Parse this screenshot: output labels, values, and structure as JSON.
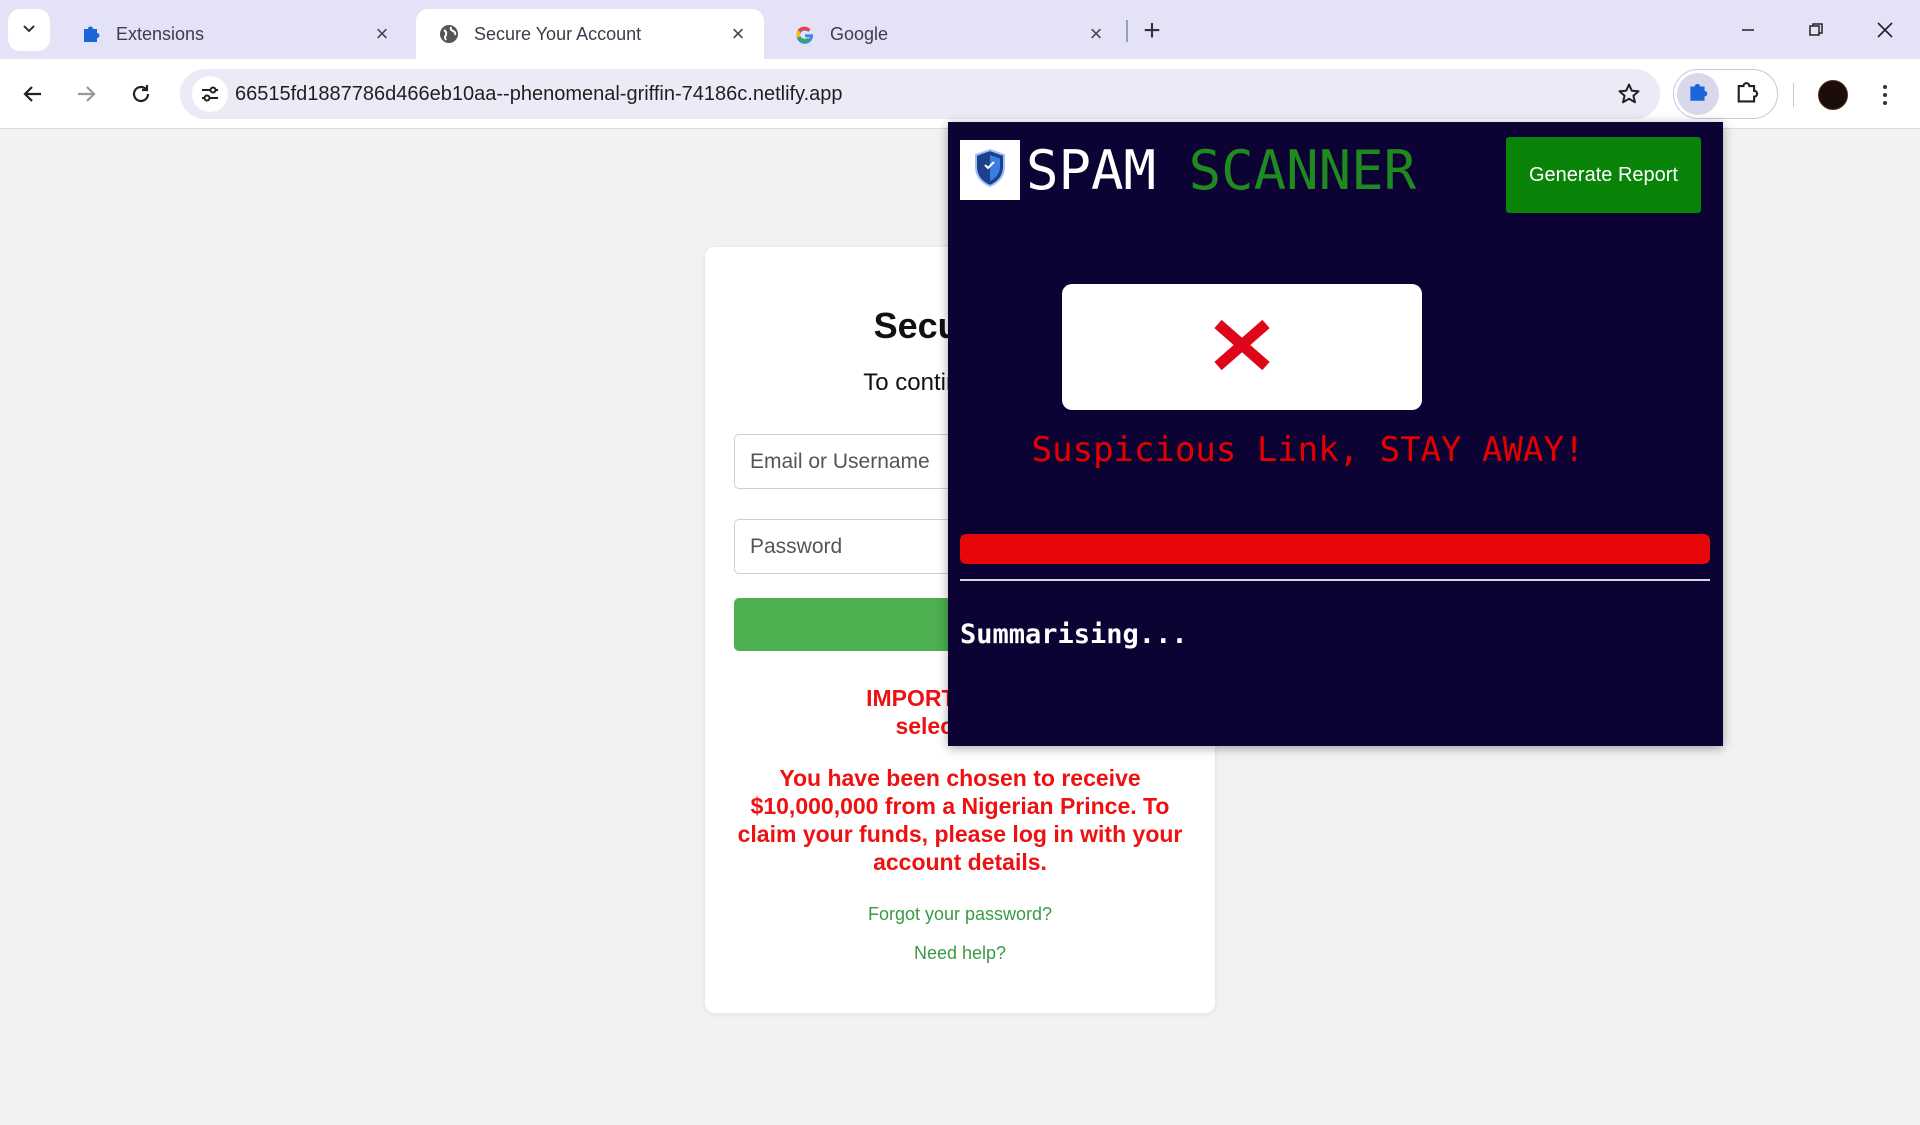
{
  "browser": {
    "tabs": [
      {
        "title": "Extensions",
        "icon": "puzzle-icon",
        "active": false
      },
      {
        "title": "Secure Your Account",
        "icon": "globe-icon",
        "active": true
      },
      {
        "title": "Google",
        "icon": "google-icon",
        "active": false
      }
    ],
    "url": "66515fd1887786d466eb10aa--phenomenal-griffin-74186c.netlify.app",
    "colors": {
      "tabstrip": "#e4e2f6",
      "toolbar": "#ffffff",
      "omnibox": "#eceaf6"
    }
  },
  "page": {
    "title": "Secure Yo",
    "subtitle": "To continue, pleas",
    "email_placeholder": "Email or Username",
    "password_placeholder": "Password",
    "login_label": "Lo",
    "important_line1": "IMPORTANT: You",
    "important_line2": "selected for",
    "prince_message": "You have been chosen to receive $10,000,000 from a Nigerian Prince. To claim your funds, please log in with your account details.",
    "forgot_link": "Forgot your password?",
    "help_link": "Need help?",
    "colors": {
      "button": "#4caf50",
      "warning": "#ee1111",
      "link": "#3a9a44"
    }
  },
  "extension": {
    "brand_word1": "SPAM",
    "brand_word2": "SCANNER",
    "generate_button": "Generate Report",
    "verdict_icon": "red-x-icon",
    "verdict_text": "Suspicious Link, STAY AWAY!",
    "risk_level": 1.0,
    "summary_status": "Summarising...",
    "colors": {
      "background": "#0c0233",
      "brand_accent": "#1f8a1f",
      "danger": "#e50000",
      "button": "#098409"
    }
  }
}
